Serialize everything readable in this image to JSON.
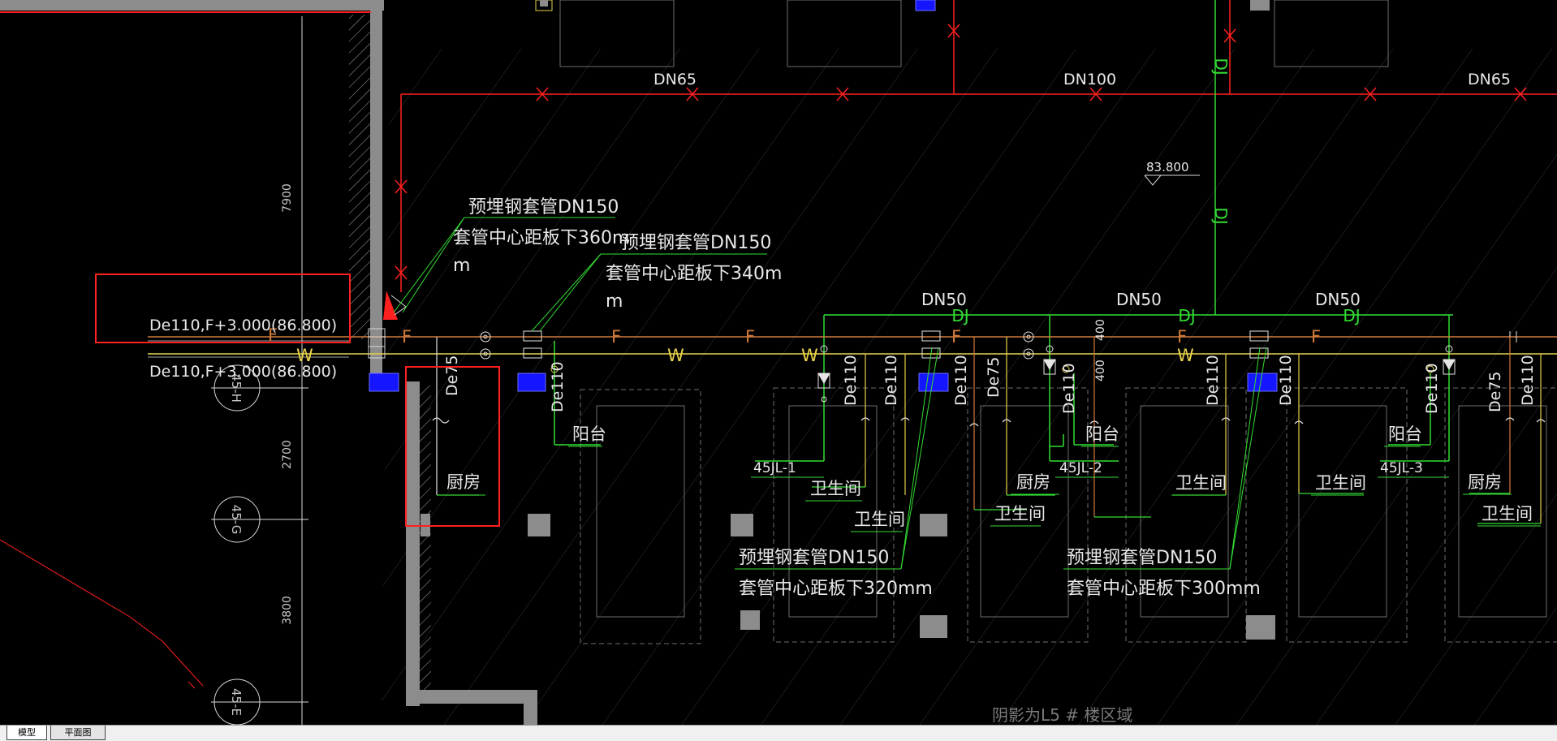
{
  "pipe_sizes": {
    "dn65": "DN65",
    "dn100": "DN100",
    "dn50": "DN50",
    "de110": "De110",
    "de75": "De75"
  },
  "pipe_codes": {
    "dj": "DJ",
    "f": "F",
    "w": "W"
  },
  "elevation_mark": "83.800",
  "dimensions": {
    "d7900": "7900",
    "d2700": "2700",
    "d3800": "3800",
    "d400": "400"
  },
  "axes": {
    "a45h": "45-H",
    "a45g": "45-G",
    "a45e": "45-E"
  },
  "annotations": {
    "sleeve_title": "预埋钢套管DN150",
    "sleeve_360_a": "套管中心距板下360m",
    "sleeve_360_b": "m",
    "sleeve_340_a": "套管中心距板下340m",
    "sleeve_340_b": "m",
    "sleeve_320": "套管中心距板下320mm",
    "sleeve_300": "套管中心距板下300mm"
  },
  "pipe_label": "De110,F+3.000(86.800)",
  "rooms": {
    "kitchen": "厨房",
    "balcony": "阳台",
    "bathroom": "卫生间"
  },
  "risers": {
    "jl1": "45JL-1",
    "jl2": "45JL-2",
    "jl3": "45JL-3"
  },
  "shade_note": "阴影为L5 # 楼区域",
  "tabs": {
    "model": "模型",
    "plan": "平面图"
  },
  "colors": {
    "background": "#000000",
    "red": "#ff2020",
    "green": "#33dd33",
    "yellow": "#e6d24a",
    "orange": "#d07a3c",
    "blue": "#1515ff",
    "wall": "#8c8c8c",
    "text": "#e8e8e8",
    "highlight_box": "#ff2020"
  }
}
